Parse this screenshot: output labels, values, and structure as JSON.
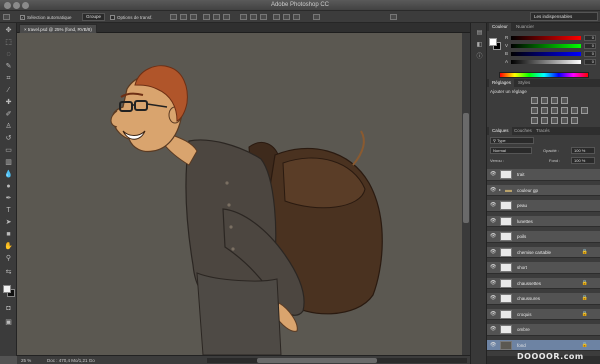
{
  "app": {
    "title": "Adobe Photoshop CC"
  },
  "options_bar": {
    "auto_select_label": "Sélection automatique",
    "auto_select_mode": "Groupe",
    "transform_label": "Options de transf."
  },
  "workspace": {
    "selected": "Les indispensables"
  },
  "document": {
    "tab_label": "travel.psd @ 25% (fond, RVB/8)"
  },
  "status": {
    "zoom": "25 %",
    "doc_info": "Doc : 470,4 Mo/1,21 Go"
  },
  "colors": {
    "accent_selected_layer": "#6d83a3",
    "canvas_bg": "#5b5851",
    "skin": "#d9a46e",
    "hair": "#b0552a",
    "shirt": "#4c4640",
    "bag": "#4a3220"
  },
  "color_panel": {
    "tabs": [
      "Couleur",
      "Nuancier"
    ],
    "sliders": [
      {
        "label": "R",
        "value": "0"
      },
      {
        "label": "V",
        "value": "0"
      },
      {
        "label": "B",
        "value": "0"
      },
      {
        "label": "A",
        "value": "0"
      }
    ]
  },
  "adjust_panel": {
    "tabs": [
      "Réglages",
      "Styles"
    ],
    "title": "Ajouter un réglage"
  },
  "layers_panel": {
    "tabs": [
      "Calques",
      "Couches",
      "Tracés"
    ],
    "filter": "Type",
    "blend_mode": "Normal",
    "opacity_label": "Opacité :",
    "opacity_value": "100 %",
    "lock_label": "Verrou :",
    "fill_label": "Fond :",
    "fill_value": "100 %",
    "layers": [
      {
        "name": "trait",
        "thumb": "light"
      },
      {
        "name": "couleur gp",
        "thumb": "folder"
      },
      {
        "name": "peau",
        "thumb": "light"
      },
      {
        "name": "lunettes",
        "thumb": "light"
      },
      {
        "name": "poils",
        "thumb": "light"
      },
      {
        "name": "chemise cartable",
        "thumb": "light",
        "locked": true
      },
      {
        "name": "short",
        "thumb": "light"
      },
      {
        "name": "chaussettes",
        "thumb": "light",
        "locked": true
      },
      {
        "name": "chaussures",
        "thumb": "light",
        "locked": true
      },
      {
        "name": "croquis",
        "thumb": "light",
        "locked": true
      },
      {
        "name": "ombre",
        "thumb": "light"
      },
      {
        "name": "fond",
        "thumb": "dark",
        "selected": true,
        "locked": true
      }
    ]
  },
  "watermark": "DOOOOR.com"
}
